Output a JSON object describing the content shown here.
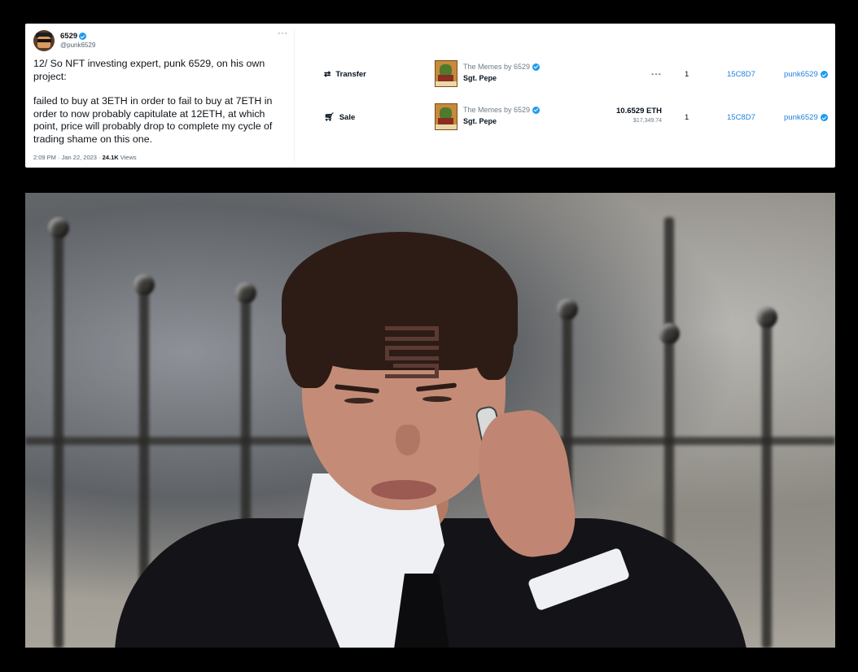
{
  "tweet": {
    "display_name": "6529",
    "handle": "@punk6529",
    "more": "···",
    "paragraph_1": "12/ So NFT investing expert, punk 6529, on his own project:",
    "paragraph_2": "failed to buy at 3ETH in order to fail to buy at 7ETH in order to now probably capitulate at 12ETH, at which point, price will probably drop to complete my cycle of trading shame on this one.",
    "time": "2:09 PM · Jan 22, 2023 · ",
    "views_count": "24.1K",
    "views_label": " Views"
  },
  "activity": {
    "rows": [
      {
        "type": "Transfer",
        "icon": "transfer-icon",
        "collection": "The Memes by 6529",
        "item": "Sgt. Pepe",
        "price": "---",
        "quantity": "1",
        "from": "15C8D7",
        "to": "punk6529"
      },
      {
        "type": "Sale",
        "icon": "cart-icon",
        "collection": "The Memes by 6529",
        "item": "Sgt. Pepe",
        "price": "10.6529 ETH",
        "price_usd": "$17,349.74",
        "quantity": "1",
        "from": "15C8D7",
        "to": "punk6529"
      }
    ]
  },
  "colors": {
    "link": "#2081e2",
    "verified": "#1d9bf0",
    "background": "#000000"
  }
}
